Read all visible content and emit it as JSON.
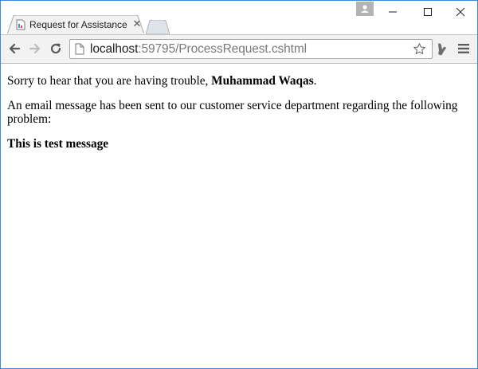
{
  "browser": {
    "tab_title": "Request for Assistance",
    "url_host": "localhost",
    "url_path": ":59795/ProcessRequest.cshtml"
  },
  "page": {
    "greeting_prefix": "Sorry to hear that you are having trouble, ",
    "user_name": "Muhammad Waqas",
    "greeting_suffix": ".",
    "notice": "An email message has been sent to our customer service department regarding the following problem:",
    "problem_message": "This is test message"
  },
  "icons": {
    "back": "arrow-left-icon",
    "forward": "arrow-right-icon",
    "reload": "reload-icon",
    "page": "page-icon",
    "bookmark": "star-icon",
    "extension": "extension-icon",
    "menu": "hamburger-menu-icon",
    "close_tab": "close-icon",
    "profile": "profile-icon"
  },
  "colors": {
    "window_border": "#3c8bd8",
    "toolbar_bg": "#f2f2f2",
    "url_host": "#1e1e1e",
    "url_path": "#7a7a7a"
  }
}
